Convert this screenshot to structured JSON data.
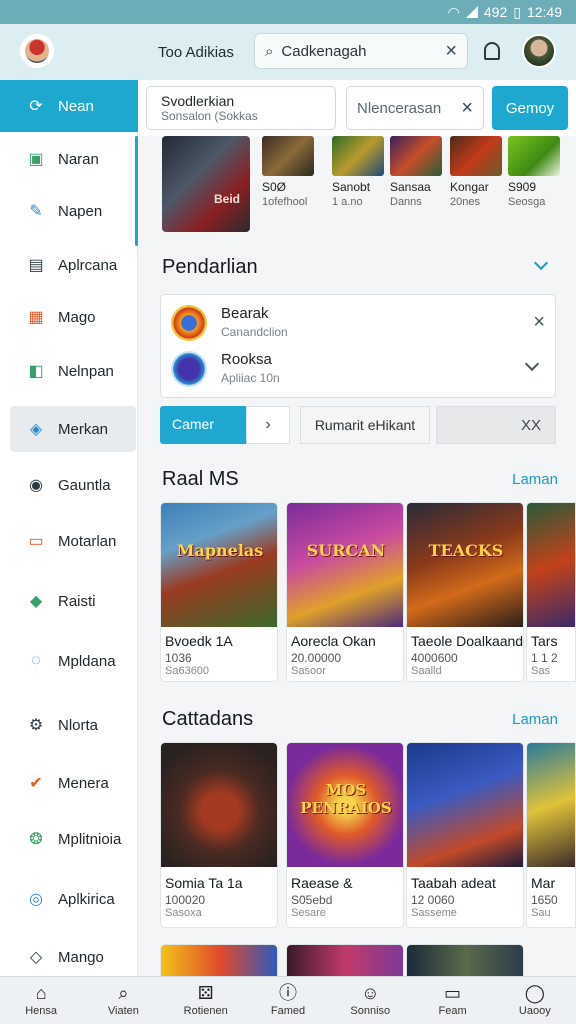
{
  "status": {
    "time": "12:49",
    "battery": "492"
  },
  "topbar": {
    "title": "Too Adikias",
    "search_value": "Cadkenagah"
  },
  "sidebar": {
    "items": [
      {
        "label": "Nean",
        "icon": "refresh-icon",
        "glyph": "⟳"
      },
      {
        "label": "Naran",
        "icon": "monitor-icon",
        "glyph": "▣"
      },
      {
        "label": "Napen",
        "icon": "edit-icon",
        "glyph": "✎"
      },
      {
        "label": "Aplrcana",
        "icon": "calendar-icon",
        "glyph": "▤"
      },
      {
        "label": "Mago",
        "icon": "calculator-icon",
        "glyph": "▦"
      },
      {
        "label": "Nelnpan",
        "icon": "folder-icon",
        "glyph": "◧"
      },
      {
        "label": "Merkan",
        "icon": "badge-icon",
        "glyph": "◈"
      },
      {
        "label": "Gauntla",
        "icon": "refresh-circle-icon",
        "glyph": "◉"
      },
      {
        "label": "Motarlan",
        "icon": "message-icon",
        "glyph": "▭"
      },
      {
        "label": "Raisti",
        "icon": "shield-icon",
        "glyph": "◆"
      },
      {
        "label": "Mpldana",
        "icon": "chat-bubble-icon",
        "glyph": "◌"
      },
      {
        "label": "Nlorta",
        "icon": "gear-icon",
        "glyph": "⚙"
      },
      {
        "label": "Menera",
        "icon": "check-circle-icon",
        "glyph": "✔"
      },
      {
        "label": "Mplitnioia",
        "icon": "cookie-icon",
        "glyph": "❂"
      },
      {
        "label": "Aplkirica",
        "icon": "target-icon",
        "glyph": "◎"
      },
      {
        "label": "Mango",
        "icon": "tag-icon",
        "glyph": "◇"
      }
    ]
  },
  "main": {
    "search1": {
      "title": "Svodlerkian",
      "subtitle": "Sonsalon (Sokkas"
    },
    "search2_placeholder": "Nlencerasan",
    "go_button": "Gemoy",
    "featured": {
      "hero_label": "Beid",
      "items": [
        {
          "line1": "S0Ø",
          "line2": "1ofefhool"
        },
        {
          "line1": "Sanobt",
          "line2": "1 a.no"
        },
        {
          "line1": "Sansaa",
          "line2": "Danns"
        },
        {
          "line1": "Kongar",
          "line2": "20nes"
        },
        {
          "line1": "S909",
          "line2": "Seosga"
        }
      ]
    },
    "pendarlian": {
      "title": "Pendarlian",
      "rows": [
        {
          "title": "Bearak",
          "subtitle": "Canandclion"
        },
        {
          "title": "Rooksa",
          "subtitle": "Apliiac 10n"
        }
      ]
    },
    "tabs": {
      "game": "Camer",
      "middle": "Rumarit eHikant",
      "end": "XX"
    },
    "section1": {
      "title": "Raal MS",
      "link": "Laman",
      "cards": [
        {
          "art_text": "Mapnelas",
          "name": "Bvoedk 1A",
          "price": "1036",
          "meta": "Sa63600"
        },
        {
          "art_text": "SURCAN",
          "name": "Aorecla Okan",
          "price": "20.00000",
          "meta": "Sasoor"
        },
        {
          "art_text": "TEACKS",
          "name": "Taeole Doalkaand",
          "price": "4000600",
          "meta": "Saalld"
        },
        {
          "art_text": "",
          "name": "Tars",
          "price": "1 1 2",
          "meta": "Sas"
        }
      ]
    },
    "section2": {
      "title": "Cattadans",
      "link": "Laman",
      "cards": [
        {
          "art_text": "",
          "name": "Somia Ta 1a",
          "price": "100020",
          "meta": "Sasoxa"
        },
        {
          "art_text": "MOS PENRAIOS",
          "name": "Raease &",
          "price": "S05ebd",
          "meta": "Sesare"
        },
        {
          "art_text": "",
          "name": "Taabah adeat",
          "price": "12 0060",
          "meta": "Sasseme"
        },
        {
          "art_text": "",
          "name": "Mar",
          "price": "1650",
          "meta": "Sau"
        }
      ]
    }
  },
  "bottom_nav": [
    {
      "label": "Hensa",
      "icon": "home-icon",
      "glyph": "⌂"
    },
    {
      "label": "Viaten",
      "icon": "search-icon",
      "glyph": "⌕"
    },
    {
      "label": "Rotienen",
      "icon": "dice-icon",
      "glyph": "⚄"
    },
    {
      "label": "Famed",
      "icon": "info-icon",
      "glyph": "ⓘ"
    },
    {
      "label": "Sonniso",
      "icon": "face-icon",
      "glyph": "☺"
    },
    {
      "label": "Feam",
      "icon": "folder-icon",
      "glyph": "▭"
    },
    {
      "label": "Uaooy",
      "icon": "chat-icon",
      "glyph": "◯"
    }
  ]
}
